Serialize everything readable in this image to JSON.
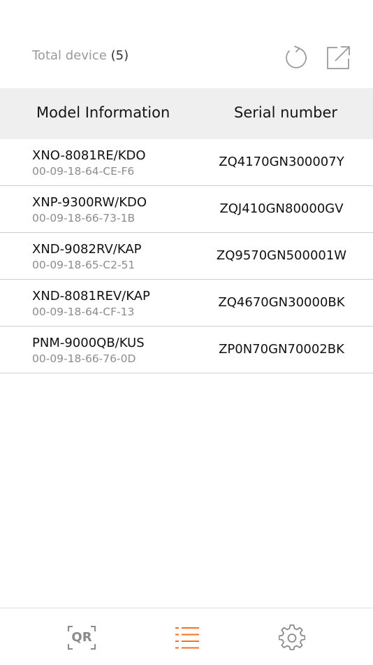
{
  "header": {
    "total_label": "Total device",
    "total_count": "(5)",
    "refresh_icon": "refresh-icon",
    "export_icon": "export-icon"
  },
  "table": {
    "columns": [
      "Model Information",
      "Serial number"
    ],
    "rows": [
      {
        "model": "XNO-8081RE/KDO",
        "mac": "00-09-18-64-CE-F6",
        "serial": "ZQ4170GN300007Y"
      },
      {
        "model": "XNP-9300RW/KDO",
        "mac": "00-09-18-66-73-1B",
        "serial": "ZQJ410GN80000GV"
      },
      {
        "model": "XND-9082RV/KAP",
        "mac": "00-09-18-65-C2-51",
        "serial": "ZQ9570GN500001W"
      },
      {
        "model": "XND-8081REV/KAP",
        "mac": "00-09-18-64-CF-13",
        "serial": "ZQ4670GN30000BK"
      },
      {
        "model": "PNM-9000QB/KUS",
        "mac": "00-09-18-66-76-0D",
        "serial": "ZP0N70GN70002BK"
      }
    ]
  },
  "tabbar": {
    "qr_label": "QR",
    "tabs": [
      "qr-scan-icon",
      "list-icon",
      "settings-gear-icon"
    ],
    "active_tab": "list-icon",
    "active_color": "#f37321",
    "inactive_color": "#8a8a8a"
  }
}
